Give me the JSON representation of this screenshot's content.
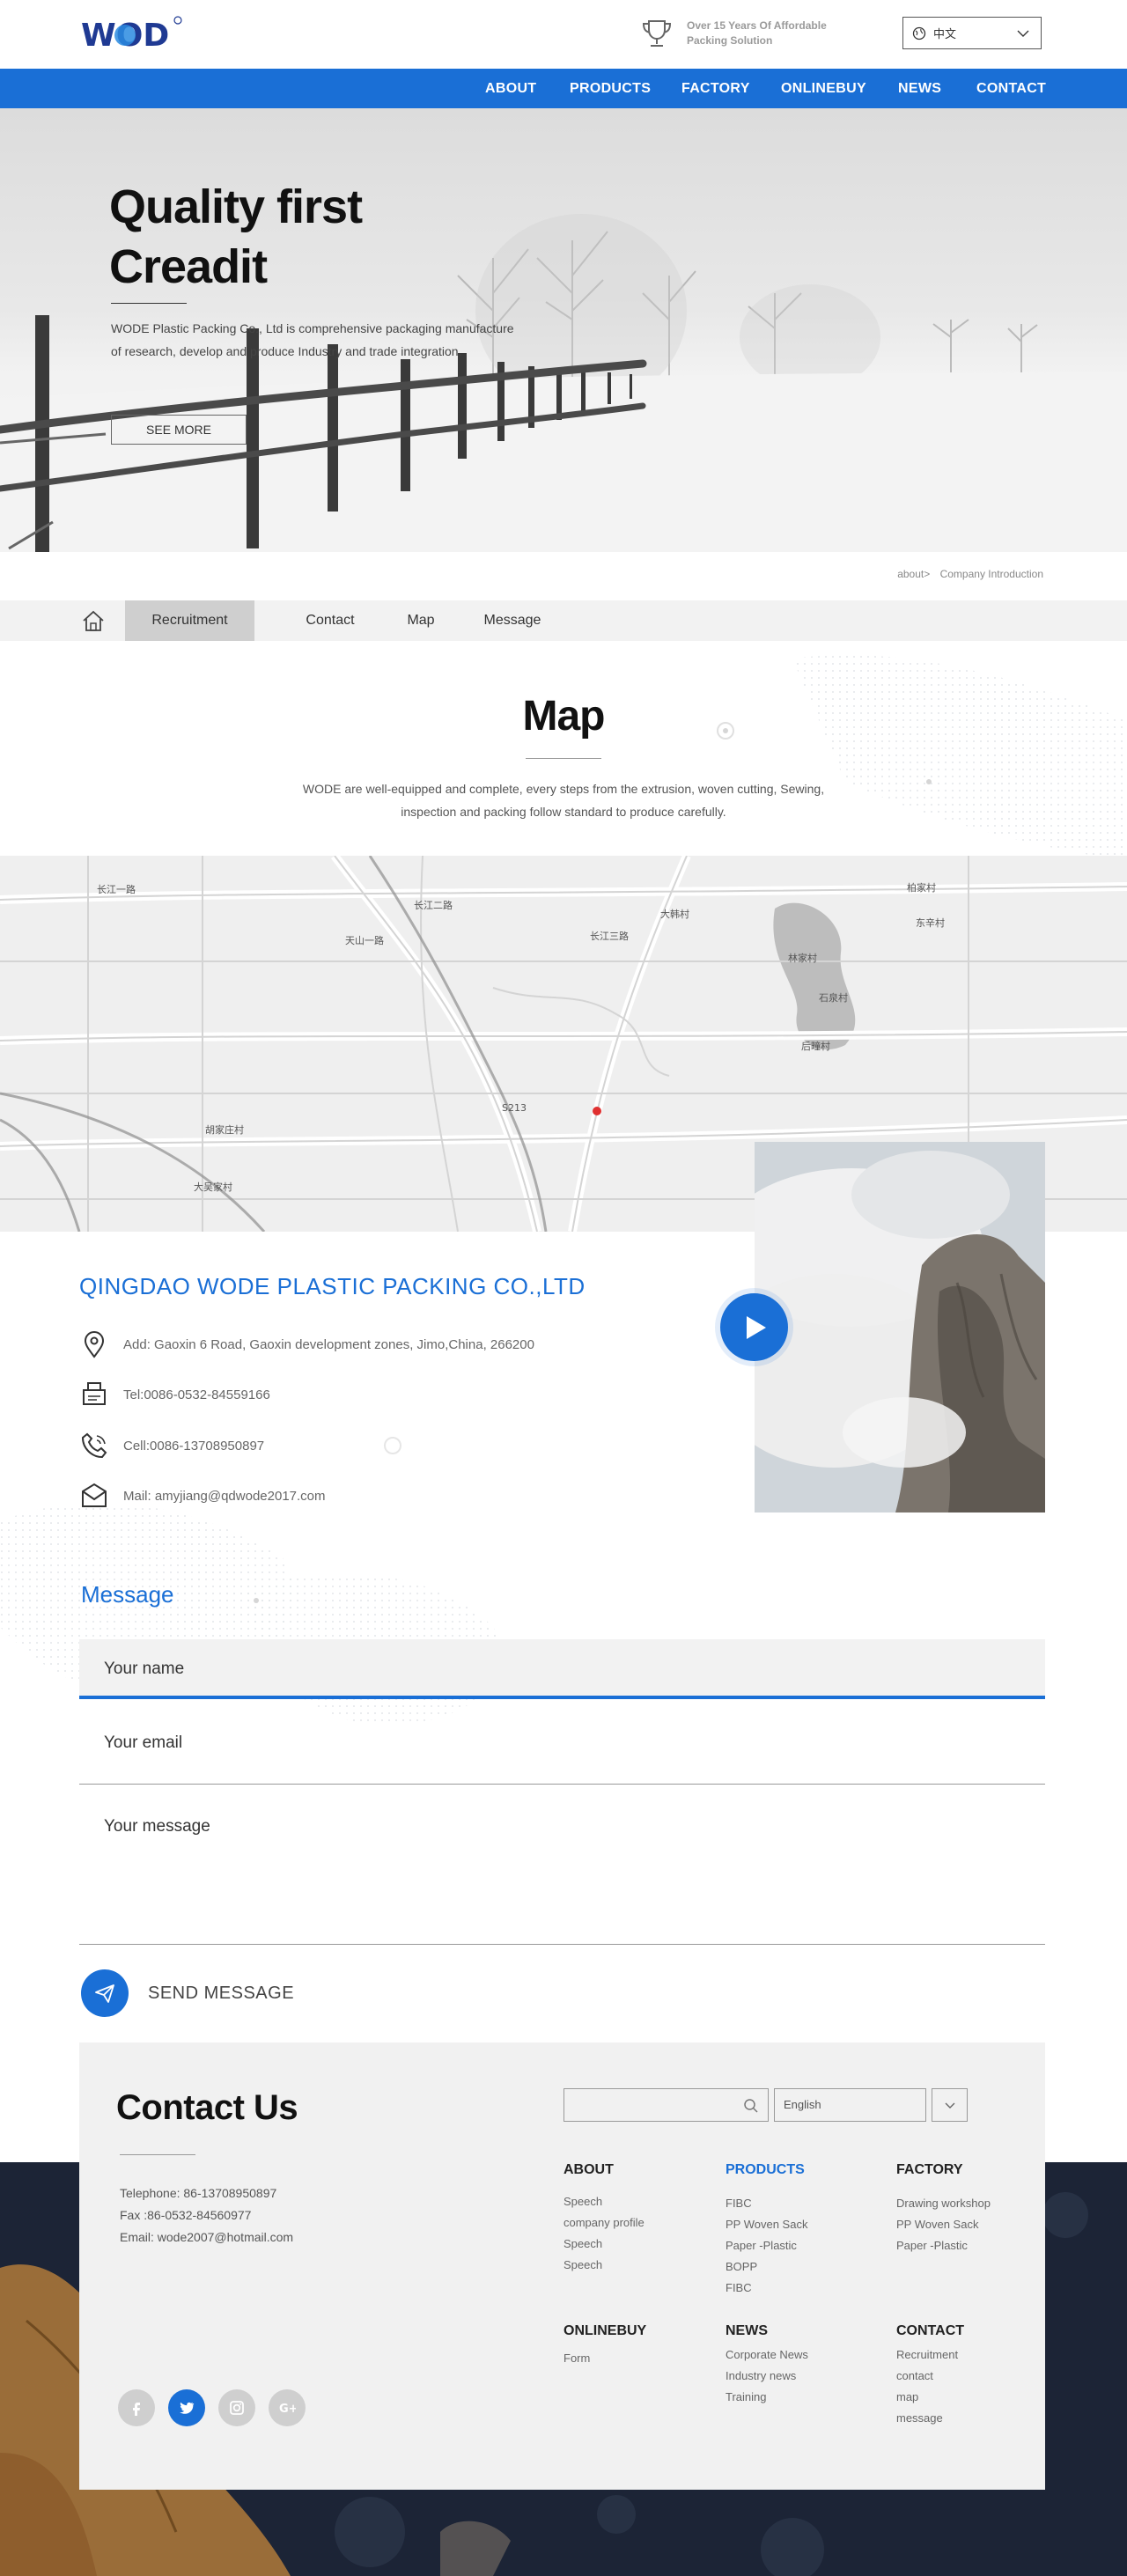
{
  "header": {
    "logo_text": "WOD",
    "award_text": "Over 15 Years Of Affordable Packing Solution",
    "language": "中文"
  },
  "nav": [
    "ABOUT",
    "PRODUCTS",
    "FACTORY",
    "ONLINEBUY",
    "NEWS",
    "CONTACT"
  ],
  "hero": {
    "title_line1": "Quality first",
    "title_line2": "Creadit",
    "description": "WODE Plastic Packing Co., Ltd is comprehensive packaging manufacture of research, develop and produce Industry and trade integration.",
    "button": "SEE MORE"
  },
  "breadcrumb": {
    "parent": "about>",
    "current": "Company Introduction"
  },
  "subnav": [
    "Recruitment",
    "Contact",
    "Map",
    "Message"
  ],
  "map_section": {
    "title": "Map",
    "description": "WODE are well-equipped and complete, every steps from the extrusion, woven cutting, Sewing, inspection and packing follow standard to produce carefully.",
    "map_labels": [
      "长江一路",
      "长江二路",
      "长江三路",
      "天山一路",
      "大韩村",
      "石泉村",
      "林家村",
      "后疃村",
      "柏家村",
      "S213",
      "胡家庄村",
      "大吴家村",
      "东辛村"
    ]
  },
  "company": {
    "name": "QINGDAO WODE PLASTIC PACKING CO.,LTD",
    "address": "Add: Gaoxin 6 Road, Gaoxin development zones, Jimo,China, 266200",
    "tel": "Tel:0086-0532-84559166",
    "cell": "Cell:0086-13708950897",
    "mail": "Mail: amyjiang@qdwode2017.com"
  },
  "message_form": {
    "title": "Message",
    "name_placeholder": "Your name",
    "email_placeholder": "Your email",
    "message_placeholder": "Your message",
    "send_label": "SEND MESSAGE"
  },
  "footer": {
    "title": "Contact Us",
    "telephone": "Telephone: 86-13708950897",
    "fax": "Fax :86-0532-84560977",
    "email": "Email: wode2007@hotmail.com",
    "language": "English",
    "columns": [
      {
        "heading": "ABOUT",
        "items": [
          "Speech",
          "company profile",
          "Speech",
          "Speech"
        ]
      },
      {
        "heading": "PRODUCTS",
        "items": [
          "FIBC",
          "PP Woven Sack",
          "Paper -Plastic",
          "BOPP",
          "FIBC"
        ]
      },
      {
        "heading": "FACTORY",
        "items": [
          "Drawing workshop",
          "PP Woven Sack",
          "Paper -Plastic"
        ]
      },
      {
        "heading": "ONLINEBUY",
        "items": [
          "Form"
        ]
      },
      {
        "heading": "NEWS",
        "items": [
          "Corporate News",
          "Industry news",
          "Training"
        ]
      },
      {
        "heading": "CONTACT",
        "items": [
          "Recruitment",
          "contact",
          "map",
          "message"
        ]
      }
    ],
    "social": [
      "facebook-icon",
      "twitter-icon",
      "instagram-icon",
      "google-plus-icon"
    ]
  },
  "colors": {
    "accent": "#1a6fd6",
    "light_gray": "#f2f2f2"
  }
}
